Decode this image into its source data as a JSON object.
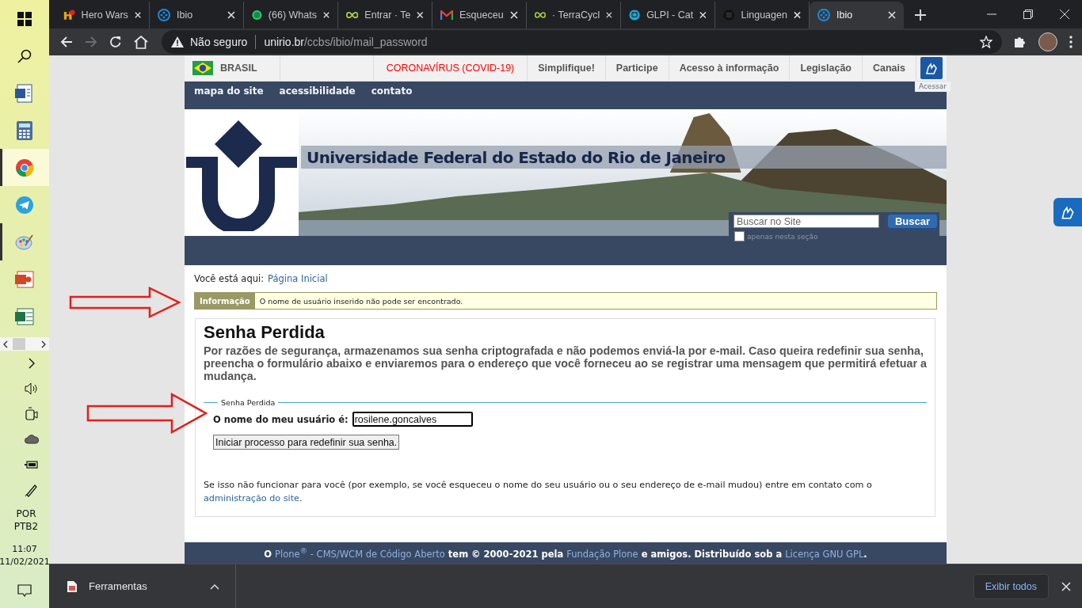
{
  "taskbar": {
    "apps": [
      {
        "kind": "start",
        "running": false,
        "selected": false
      },
      {
        "kind": "search",
        "running": false,
        "selected": false
      },
      {
        "kind": "word",
        "running": false,
        "selected": false
      },
      {
        "kind": "calculator",
        "running": false,
        "selected": false
      },
      {
        "kind": "chrome",
        "running": true,
        "selected": true
      },
      {
        "kind": "telegram",
        "running": false,
        "selected": false
      },
      {
        "kind": "paint",
        "running": true,
        "selected": false
      },
      {
        "kind": "powerpoint",
        "running": false,
        "selected": false
      },
      {
        "kind": "excel",
        "running": false,
        "selected": false
      }
    ],
    "tray": [
      {
        "kind": "chevron"
      },
      {
        "kind": "volume"
      },
      {
        "kind": "meet"
      },
      {
        "kind": "cloud"
      },
      {
        "kind": "battery"
      },
      {
        "kind": "pen"
      }
    ],
    "language": "POR",
    "layout": "PTB2",
    "time": "11:07",
    "date": "11/02/2021"
  },
  "browser": {
    "tabs": [
      {
        "title": "Hero Wars",
        "kind": "helmet",
        "selected": false
      },
      {
        "title": "Ibio",
        "kind": "dots",
        "selected": false
      },
      {
        "title": "(66) Whats",
        "kind": "chat",
        "selected": false
      },
      {
        "title": "Entrar · Te",
        "kind": "infinity",
        "selected": false
      },
      {
        "title": "Esqueceu",
        "kind": "envelope",
        "selected": false
      },
      {
        "title": "· TerraCycl",
        "kind": "infinity",
        "selected": false
      },
      {
        "title": "GLPI - Cat",
        "kind": "bubble",
        "selected": false
      },
      {
        "title": "Linguagen",
        "kind": "lines",
        "selected": false
      },
      {
        "title": "Ibio",
        "kind": "dots",
        "selected": true
      }
    ],
    "nav": {
      "forward_disabled": true
    },
    "address": {
      "security": "Não seguro",
      "domain": "unirio.br",
      "path": "/ccbs/ibio/mail_password"
    }
  },
  "page": {
    "gov_bar": {
      "country": "BRASIL",
      "links": [
        {
          "label": "CORONAVÍRUS (COVID-19)",
          "kind": "alert"
        },
        {
          "label": "Simplifique!",
          "kind": "link"
        },
        {
          "label": "Participe",
          "kind": "link"
        },
        {
          "label": "Acesso à informação",
          "kind": "link"
        },
        {
          "label": "Legislação",
          "kind": "link"
        },
        {
          "label": "Canais",
          "kind": "link"
        }
      ],
      "access_label": "Acessar"
    },
    "portal_nav": [
      "mapa do site",
      "acessibilidade",
      "contato"
    ],
    "banner": {
      "title": "Universidade Federal do Estado do Rio de Janeiro"
    },
    "search": {
      "placeholder": "Buscar no Site",
      "button": "Buscar",
      "checkbox_label": "apenas nesta seção",
      "checked": false
    },
    "breadcrumb": {
      "label": "Você está aqui:",
      "link": "Página Inicial"
    },
    "message": {
      "type": "Informação",
      "text": "O nome de usuário inserido não pode ser encontrado."
    },
    "form": {
      "title": "Senha Perdida",
      "description": "Por razões de segurança, armazenamos sua senha criptografada e não podemos enviá-la por e-mail. Caso queira redefinir sua senha, preencha o formulário abaixo e enviaremos para o endereço que você forneceu ao se registrar uma mensagem que permitirá efetuar a mudança.",
      "legend": "Senha Perdida",
      "field_label": "O nome do meu usuário é:",
      "field_value": "rosilene.goncalves",
      "submit": "Iniciar processo para redefinir sua senha."
    },
    "help": {
      "text": "Se isso não funcionar para você (por exemplo, se você esqueceu o nome do seu usuário ou o seu endereço de e-mail mudou) entre em contato com o ",
      "link": "administração do site",
      "end": "."
    },
    "footer": {
      "parts": [
        "O ",
        " tem © 2000-2021 pela ",
        " e amigos. Distribuído sob a ",
        "."
      ],
      "links": [
        "Plone$^{®}$ - CMS/WCM de Código Aberto",
        "Fundação Plone",
        "Licença GNU GPL"
      ]
    }
  },
  "downloads": {
    "file": "Ferramentas",
    "show_all": "Exibir todos"
  }
}
